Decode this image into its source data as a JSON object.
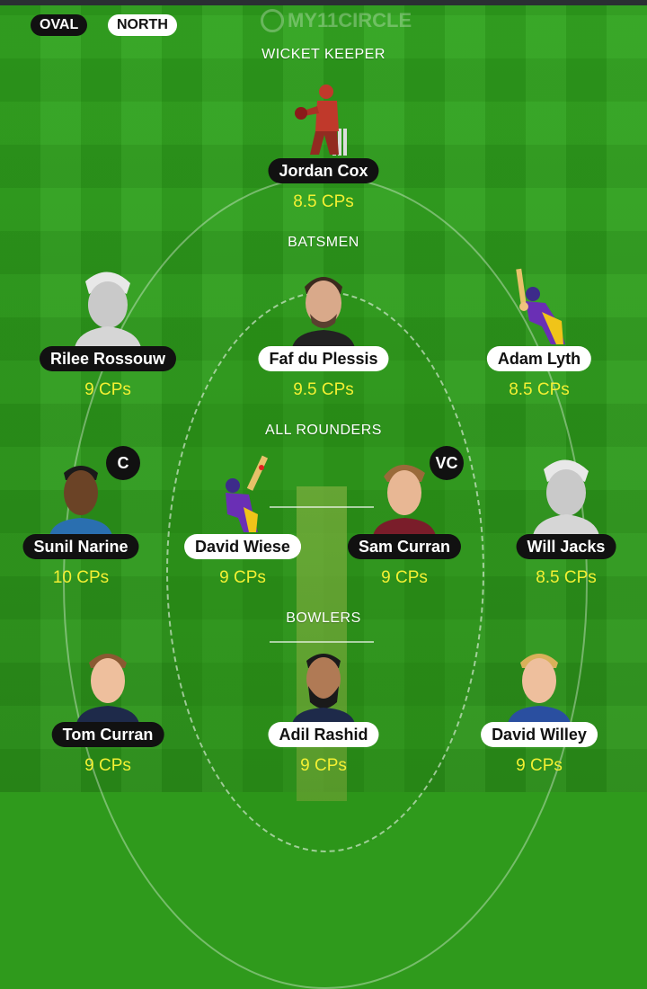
{
  "teams": {
    "home": "OVAL",
    "away": "NORTH"
  },
  "logo": {
    "text": "MY11CIRCLE"
  },
  "sections": {
    "wicket_keeper": "WICKET KEEPER",
    "batsmen": "BATSMEN",
    "all_rounders": "ALL ROUNDERS",
    "bowlers": "BOWLERS"
  },
  "players": {
    "wk1": {
      "name": "Jordan Cox",
      "cps": "8.5 CPs"
    },
    "bat1": {
      "name": "Rilee Rossouw",
      "cps": "9 CPs"
    },
    "bat2": {
      "name": "Faf du Plessis",
      "cps": "9.5 CPs"
    },
    "bat3": {
      "name": "Adam Lyth",
      "cps": "8.5 CPs"
    },
    "ar1": {
      "name": "Sunil Narine",
      "cps": "10 CPs",
      "badge": "C"
    },
    "ar2": {
      "name": "David Wiese",
      "cps": "9 CPs"
    },
    "ar3": {
      "name": "Sam Curran",
      "cps": "9 CPs",
      "badge": "VC"
    },
    "ar4": {
      "name": "Will Jacks",
      "cps": "8.5 CPs"
    },
    "bowl1": {
      "name": "Tom Curran",
      "cps": "9 CPs"
    },
    "bowl2": {
      "name": "Adil Rashid",
      "cps": "9 CPs"
    },
    "bowl3": {
      "name": "David Willey",
      "cps": "9 CPs"
    }
  },
  "colors": {
    "field": "#2f9a1c",
    "cps_text": "#f3f033",
    "dark_pill": "#111111",
    "light_pill": "#ffffff"
  }
}
